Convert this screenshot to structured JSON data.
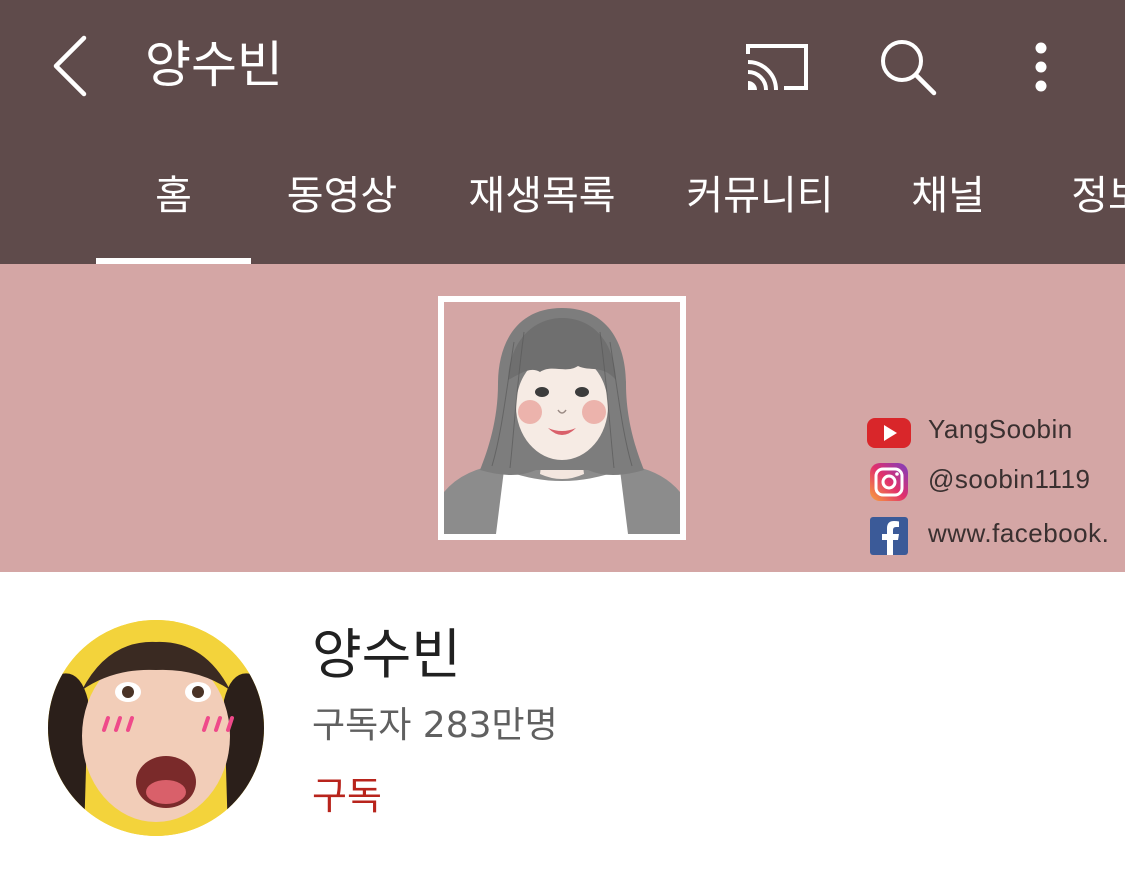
{
  "app_bar": {
    "title": "양수빈",
    "icons": {
      "back": "back-arrow-icon",
      "cast": "cast-icon",
      "search": "search-icon",
      "more": "more-vert-icon"
    },
    "background_color": "#5f4b4b"
  },
  "tabs": [
    {
      "label": "홈",
      "selected": true
    },
    {
      "label": "동영상",
      "selected": false
    },
    {
      "label": "재생목록",
      "selected": false
    },
    {
      "label": "커뮤니티",
      "selected": false
    },
    {
      "label": "채널",
      "selected": false
    },
    {
      "label": "정보",
      "selected": false
    }
  ],
  "banner": {
    "background_color": "#d4a6a5",
    "social_links": [
      {
        "icon": "youtube-icon",
        "text": "YangSoobin"
      },
      {
        "icon": "instagram-icon",
        "text": "@soobin1119"
      },
      {
        "icon": "facebook-icon",
        "text": "www.facebook."
      }
    ]
  },
  "channel": {
    "name": "양수빈",
    "subscribers": "구독자 283만명",
    "subscribe_label": "구독",
    "subscribe_color": "#b8241c"
  }
}
